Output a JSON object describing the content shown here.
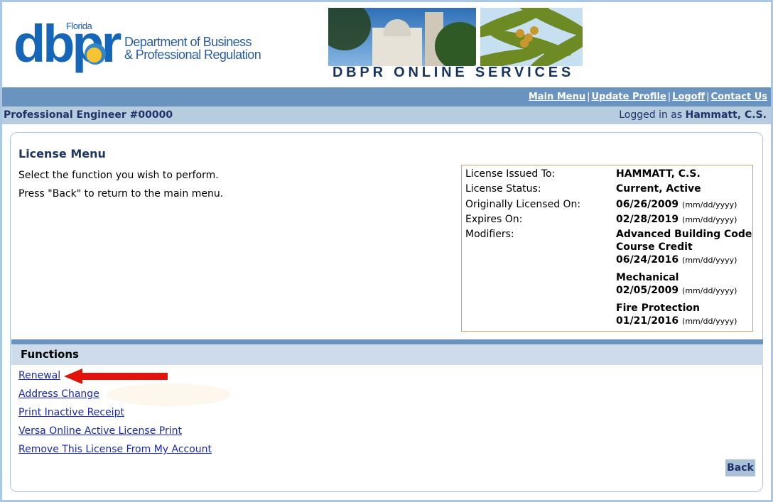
{
  "logo": {
    "florida": "Florida",
    "dbpr": "dbpr",
    "dept_line1": "Department of Business",
    "dept_line2": "& Professional Regulation"
  },
  "banner": {
    "text": "DBPR ONLINE SERVICES"
  },
  "nav": {
    "items": [
      "Main Menu",
      "Update Profile",
      "Logoff",
      "Contact Us"
    ],
    "separator": "|"
  },
  "titlebar": {
    "license": "Professional Engineer #00000",
    "logged_in_prefix": "Logged in as",
    "user": "Hammatt, C.S."
  },
  "main": {
    "title": "License Menu",
    "intro1": "Select the function you wish to perform.",
    "intro2": "Press \"Back\" to return to the main menu."
  },
  "info": {
    "issued_to_label": "License Issued To:",
    "issued_to": "HAMMATT, C.S.",
    "status_label": "License Status:",
    "status": "Current, Active",
    "orig_label": "Originally Licensed On:",
    "orig_date": "06/26/2009",
    "expires_label": "Expires On:",
    "expires_date": "02/28/2019",
    "modifiers_label": "Modifiers:",
    "date_format": "(mm/dd/yyyy)",
    "modifiers": [
      {
        "name_line1": "Advanced Building Code",
        "name_line2": "Course Credit",
        "date": "06/24/2016"
      },
      {
        "name_line1": "Mechanical",
        "date": "02/05/2009"
      },
      {
        "name_line1": "Fire Protection",
        "date": "01/21/2016"
      }
    ]
  },
  "functions": {
    "header": "Functions",
    "items": [
      "Renewal",
      "Address Change",
      "Print Inactive Receipt",
      "Versa Online Active License Print",
      "Remove This License From My Account"
    ]
  },
  "back_button": "Back",
  "colors": {
    "nav_bar": "#6b93bf",
    "title_bar": "#b7ccdf",
    "functions_header": "#cddbea",
    "link": "#1a27b8",
    "arrow": "#e3120b",
    "info_border": "#c8a464"
  }
}
